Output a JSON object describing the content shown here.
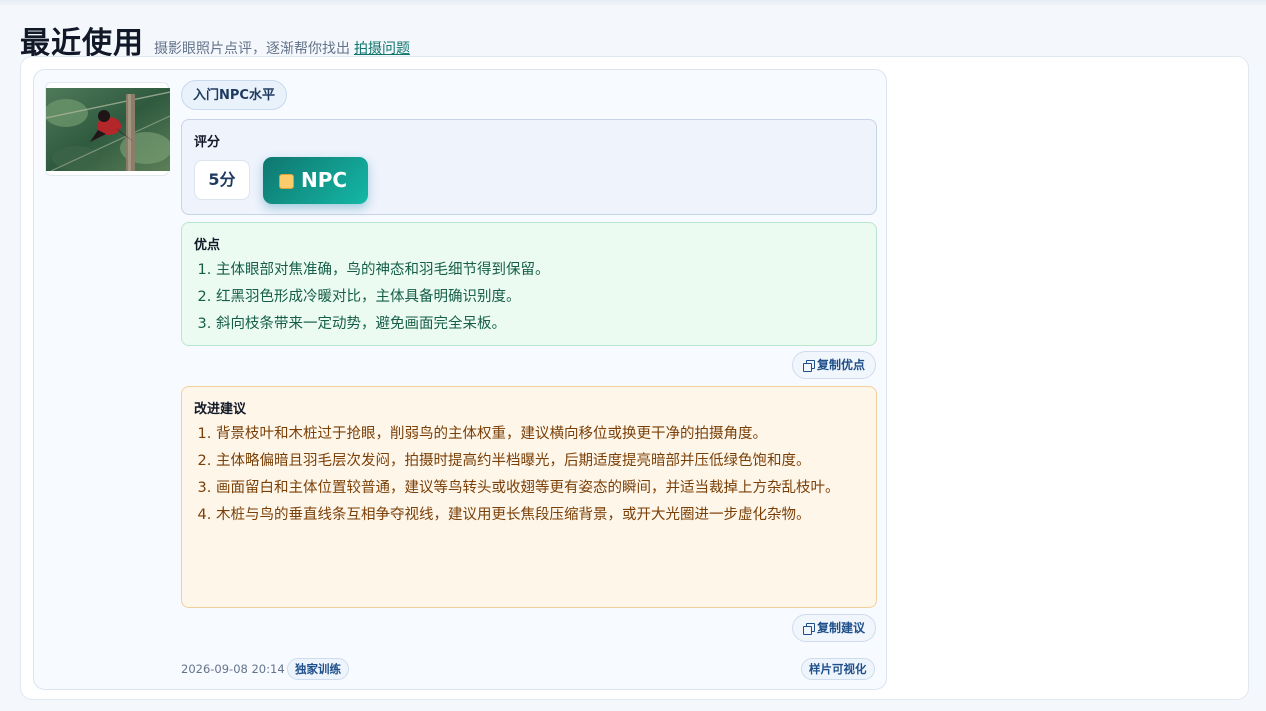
{
  "header": {
    "title": "最近使用",
    "subtitle": "摄影眼照片点评，逐渐帮你找出",
    "link": "拍摄问题"
  },
  "card": {
    "level_pill": "入门NPC水平",
    "score": {
      "title": "评分",
      "value": "5分",
      "badge": "NPC"
    },
    "pros": {
      "title": "优点",
      "items": [
        "主体眼部对焦准确，鸟的神态和羽毛细节得到保留。",
        "红黑羽色形成冷暖对比，主体具备明确识别度。",
        "斜向枝条带来一定动势，避免画面完全呆板。"
      ],
      "copy_label": "复制优点"
    },
    "cons": {
      "title": "改进建议",
      "items": [
        "背景枝叶和木桩过于抢眼，削弱鸟的主体权重，建议横向移位或换更干净的拍摄角度。",
        "主体略偏暗且羽毛层次发闷，拍摄时提高约半档曝光，后期适度提亮暗部并压低绿色饱和度。",
        "画面留白和主体位置较普通，建议等鸟转头或收翅等更有姿态的瞬间，并适当裁掉上方杂乱枝叶。",
        "木桩与鸟的垂直线条互相争夺视线，建议用更长焦段压缩背景，或开大光圈进一步虚化杂物。"
      ],
      "copy_label": "复制建议"
    },
    "footer": {
      "date": "2026-09-08 20:14",
      "tag": "独家训练",
      "visualize": "样片可视化"
    }
  },
  "colors": {
    "accent": "#0f766e",
    "badge_gradient_end": "#14b8a6",
    "pros_bg": "#ebfbf2",
    "cons_bg": "#fff6ea"
  },
  "icons": [
    "copy-icon"
  ]
}
